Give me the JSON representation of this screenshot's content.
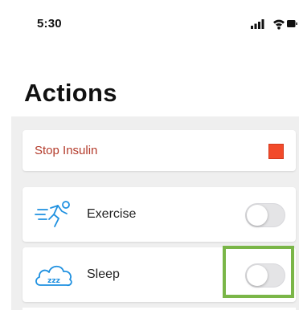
{
  "status_bar": {
    "time": "5:30",
    "icons": [
      "signal-icon",
      "wifi-icon",
      "battery-icon"
    ]
  },
  "header": {
    "title": "Actions"
  },
  "actions": {
    "stop_insulin": {
      "label": "Stop Insulin",
      "indicator_color": "#f24a2a"
    },
    "items": [
      {
        "label": "Exercise",
        "icon": "exercise-icon",
        "toggle_on": false
      },
      {
        "label": "Sleep",
        "icon": "sleep-icon",
        "toggle_on": false
      }
    ]
  },
  "colors": {
    "accent_blue": "#1e90e0",
    "stop_text": "#b33a2a",
    "highlight": "#7ab648"
  }
}
